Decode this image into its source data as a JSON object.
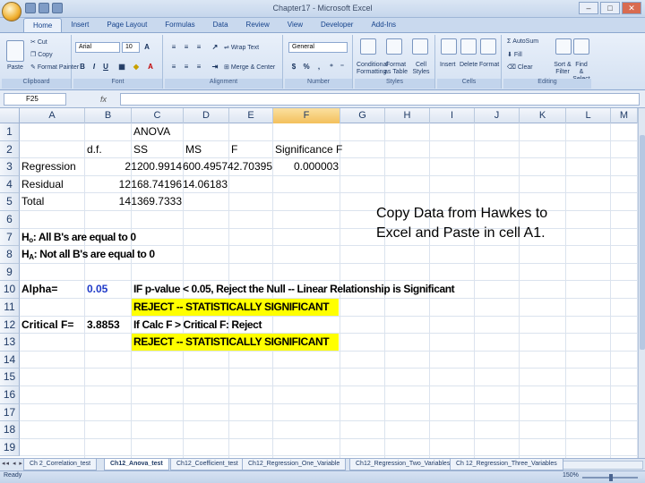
{
  "window": {
    "title": "Chapter17 - Microsoft Excel"
  },
  "tabs": [
    "Home",
    "Insert",
    "Page Layout",
    "Formulas",
    "Data",
    "Review",
    "View",
    "Developer",
    "Add-Ins"
  ],
  "ribbon": {
    "clipboard": {
      "label": "Clipboard",
      "paste": "Paste",
      "cut": "Cut",
      "copy": "Copy",
      "format_painter": "Format Painter"
    },
    "font": {
      "label": "Font",
      "name": "Arial",
      "size": "10"
    },
    "alignment": {
      "label": "Alignment",
      "wrap": "Wrap Text",
      "merge": "Merge & Center"
    },
    "number": {
      "label": "Number",
      "format": "General",
      "currency": "$",
      "percent": "%"
    },
    "styles": {
      "label": "Styles",
      "conditional": "Conditional Formatting",
      "format_table": "Format as Table",
      "cell_styles": "Cell Styles"
    },
    "cells": {
      "label": "Cells",
      "insert": "Insert",
      "delete": "Delete",
      "format": "Format"
    },
    "editing": {
      "label": "Editing",
      "autosum": "AutoSum",
      "fill": "Fill",
      "clear": "Clear",
      "sort": "Sort & Filter",
      "find": "Find & Select"
    }
  },
  "formula_bar": {
    "name_box": "F25",
    "fx": "fx",
    "content": ""
  },
  "columns": [
    "A",
    "B",
    "C",
    "D",
    "E",
    "F",
    "G",
    "H",
    "I",
    "J",
    "K",
    "L",
    "M"
  ],
  "selected_column": "F",
  "rows": [
    "1",
    "2",
    "3",
    "4",
    "5",
    "6",
    "7",
    "8",
    "9",
    "10",
    "11",
    "12",
    "13",
    "14",
    "15",
    "16",
    "17",
    "18",
    "19"
  ],
  "cells": {
    "C1": "ANOVA",
    "B2": "d.f.",
    "C2": "SS",
    "D2": "MS",
    "E2": "F",
    "F2": "Significance F",
    "A3": "Regression",
    "B3": "2",
    "C3": "1200.9914",
    "D3": "600.4957",
    "E3": "42.70395",
    "F3": "0.000003",
    "A4": "Residual",
    "B4": "12",
    "C4": "168.74196",
    "D4": "14.06183",
    "A5": "Total",
    "B5": "14",
    "C5": "1369.7333",
    "A7_main": "H",
    "A7_sub": "o",
    "A7_rest": ": All B's are equal to 0",
    "A8_main": "H",
    "A8_sub": "A",
    "A8_rest": ": Not all B's are equal to 0",
    "A10": "Alpha=",
    "B10": "0.05",
    "C10": "IF p-value < 0.05, Reject the Null -- Linear Relationship is Significant",
    "C11": "REJECT -- STATISTICALLY SIGNIFICANT",
    "A12": "Critical F=",
    "B12": "3.8853",
    "C12": "If Calc F > Critical F: Reject",
    "C13": "REJECT -- STATISTICALLY SIGNIFICANT"
  },
  "note": {
    "line1": "Copy Data from Hawkes to",
    "line2": "Excel and Paste in cell A1."
  },
  "sheets": [
    "Ch 2_Correlation_test",
    "Ch12_Anova_test",
    "Ch12_Coefficient_test",
    "Ch12_Regression_One_Variable",
    "Ch12_Regression_Two_Variables",
    "Ch 12_Regression_Three_Variables"
  ],
  "active_sheet": "Ch12_Anova_test",
  "status": {
    "ready": "Ready",
    "zoom": "150%"
  },
  "colors": {
    "highlight": "#ffff00",
    "alpha_value": "#1f3ac8",
    "selected_header": "#f3c05c"
  }
}
